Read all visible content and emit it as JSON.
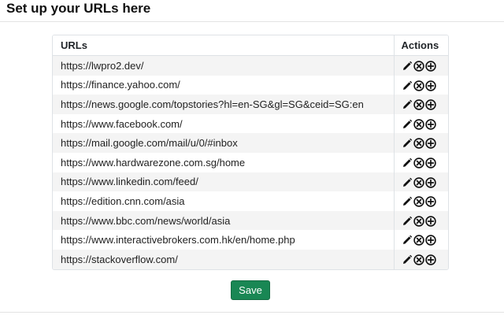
{
  "page": {
    "title": "Set up your URLs here"
  },
  "table": {
    "headers": {
      "urls": "URLs",
      "actions": "Actions"
    },
    "rows": [
      {
        "url": "https://lwpro2.dev/"
      },
      {
        "url": "https://finance.yahoo.com/"
      },
      {
        "url": "https://news.google.com/topstories?hl=en-SG&gl=SG&ceid=SG:en"
      },
      {
        "url": "https://www.facebook.com/"
      },
      {
        "url": "https://mail.google.com/mail/u/0/#inbox"
      },
      {
        "url": "https://www.hardwarezone.com.sg/home"
      },
      {
        "url": "https://www.linkedin.com/feed/"
      },
      {
        "url": "https://edition.cnn.com/asia"
      },
      {
        "url": "https://www.bbc.com/news/world/asia"
      },
      {
        "url": "https://www.interactivebrokers.com.hk/en/home.php"
      },
      {
        "url": "https://stackoverflow.com/"
      }
    ],
    "row_actions": [
      "pencil-icon",
      "remove-circle-icon",
      "add-circle-icon"
    ]
  },
  "footer": {
    "save_label": "Save",
    "save_color": "#198754"
  }
}
